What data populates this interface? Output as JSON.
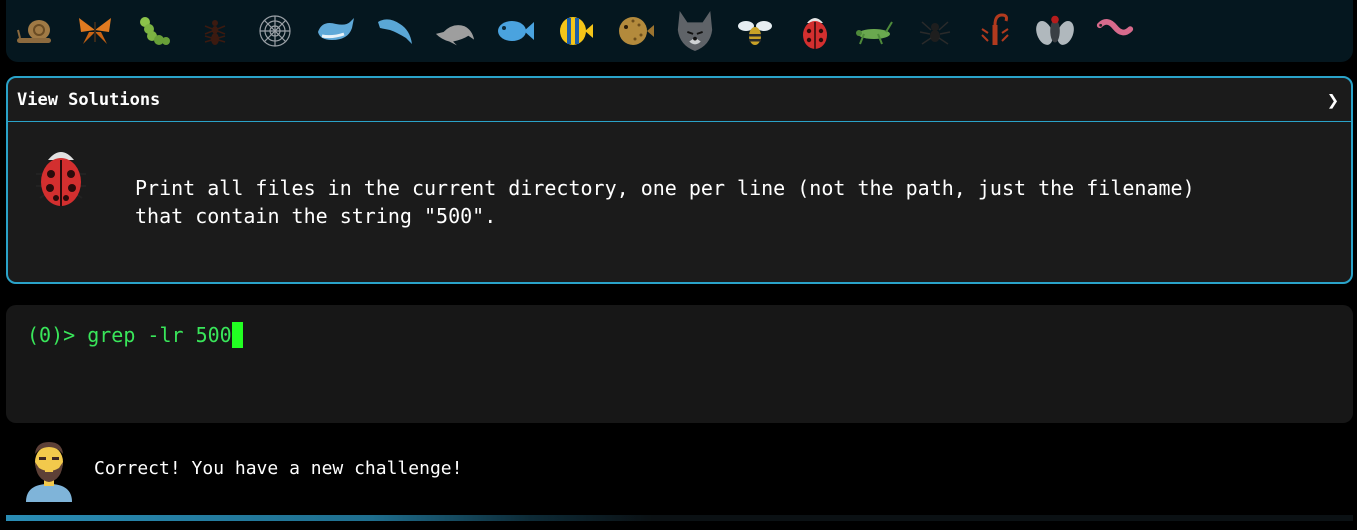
{
  "level_bar": {
    "icons": [
      "snail-icon",
      "butterfly-icon",
      "caterpillar-icon",
      "ant-icon",
      "spider-web-icon",
      "whale-icon",
      "dolphin-icon",
      "dolphin-gray-icon",
      "fish-icon",
      "tropical-fish-icon",
      "pufferfish-icon",
      "wolf-icon",
      "bee-icon",
      "ladybug-icon",
      "cricket-icon",
      "spider-icon",
      "scorpion-icon",
      "fly-icon",
      "worm-icon"
    ]
  },
  "solutions": {
    "header_label": "View Solutions",
    "chevron": "❯",
    "challenge_icon": "ladybug-icon",
    "challenge_text": "Print all files in the current directory, one per line (not the path, just the filename)\nthat contain the string \"500\"."
  },
  "terminal": {
    "prompt": "(0)> ",
    "command": "grep -lr 500"
  },
  "feedback": {
    "avatar_icon": "bearded-man-icon",
    "message": "Correct! You have a new challenge!"
  },
  "progress": {
    "fraction": 0.6
  },
  "colors": {
    "accent": "#2aa3c9",
    "terminal_text": "#39e65a",
    "cursor": "#22ff22"
  }
}
